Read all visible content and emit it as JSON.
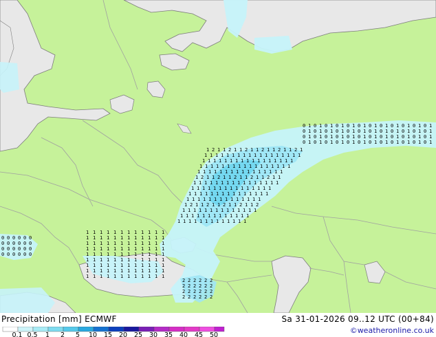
{
  "legend": {
    "title": "Precipitation [mm] ECMWF",
    "timestamp": "Sa 31-01-2026 09..12 UTC (00+84)",
    "credit": "©weatheronline.co.uk",
    "levels": [
      "0.1",
      "0.5",
      "1",
      "2",
      "5",
      "10",
      "15",
      "20",
      "25",
      "30",
      "35",
      "40",
      "45",
      "50"
    ],
    "colors": [
      "#ffffff",
      "#cdf4f9",
      "#a8ebf5",
      "#7fdcf0",
      "#56c9ea",
      "#2aa9e0",
      "#1673d1",
      "#0c40bd",
      "#1a1a9e",
      "#7a1fb5",
      "#b42bc6",
      "#d52ec5",
      "#e33ac7",
      "#ef4ee0",
      "#c020d0"
    ]
  },
  "map_colors": {
    "land": "#c6f29a",
    "sea": "#e8e8e8",
    "border": "#a0a0a0",
    "coast": "#7c7c7c",
    "precip_light": "#c6f3fa",
    "precip_mid": "#9ee6f5",
    "precip_strong": "#6fd6ef"
  }
}
